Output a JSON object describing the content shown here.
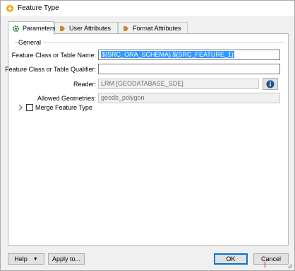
{
  "window": {
    "title": "Feature Type"
  },
  "tabs": [
    {
      "label": "Parameters",
      "icon": "gear-icon",
      "active": true
    },
    {
      "label": "User Attributes",
      "icon": "arrow-right-icon",
      "active": false
    },
    {
      "label": "Format Attributes",
      "icon": "arrow-right-icon",
      "active": false
    }
  ],
  "general": {
    "label": "General",
    "feature_class_label": "Feature Class or Table Name:",
    "feature_class_value": "$(SRC_ORA_SCHEMA).$(SRC_FEATURE_1)",
    "qualifier_label": "Feature Class or Table Qualifier:",
    "qualifier_value": "",
    "reader_label": "Reader:",
    "reader_value": "LRM [GEODATABASE_SDE]",
    "geometries_label": "Allowed Geometries:",
    "geometries_value": "geodb_polygon"
  },
  "merge": {
    "label": "Merge Feature Type",
    "checked": false
  },
  "footer": {
    "help_label": "Help",
    "apply_label": "Apply to...",
    "ok_label": "OK",
    "cancel_label": "Cancel"
  },
  "colors": {
    "selection": "#3399ff",
    "default_button_border": "#0078d7",
    "info_icon": "#1f4e8c"
  }
}
